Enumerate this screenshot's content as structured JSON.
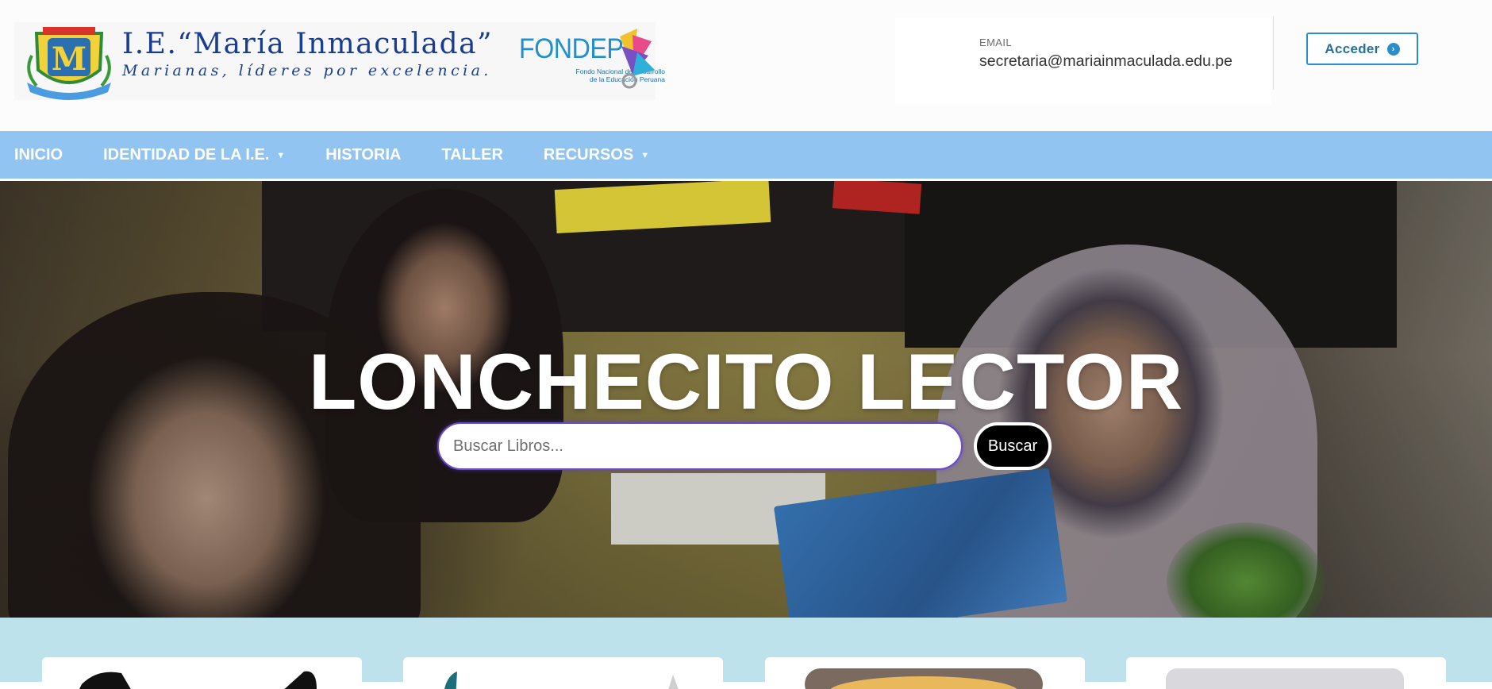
{
  "header": {
    "logo": {
      "title": "I.E.“María Inmaculada”",
      "slogan": "Marianas, líderes por excelencia.",
      "partner_name": "FONDEP",
      "partner_subtitle_line1": "Fondo Nacional de Desarrollo",
      "partner_subtitle_line2": "de la Educación Peruana"
    },
    "contact": {
      "email_label": "EMAIL",
      "email_value": "secretaria@mariainmaculada.edu.pe"
    },
    "login_button": {
      "label": "Acceder",
      "icon": "chevron-circle-right-icon"
    }
  },
  "nav": {
    "items": [
      {
        "label": "INICIO",
        "has_dropdown": false
      },
      {
        "label": "IDENTIDAD DE LA I.E.",
        "has_dropdown": true
      },
      {
        "label": "HISTORIA",
        "has_dropdown": false
      },
      {
        "label": "TALLER",
        "has_dropdown": false
      },
      {
        "label": "RECURSOS",
        "has_dropdown": true
      }
    ],
    "background_color": "#92c4f1"
  },
  "hero": {
    "title": "LONCHECITO LECTOR",
    "search": {
      "placeholder": "Buscar Libros...",
      "value": "",
      "button_label": "Buscar"
    }
  },
  "cards_section": {
    "background_color": "#bde2ec",
    "card_count_visible": 4
  },
  "colors": {
    "accent_blue": "#2a8fc8",
    "brand_navy": "#1a3d8f",
    "search_button": "#000000"
  }
}
